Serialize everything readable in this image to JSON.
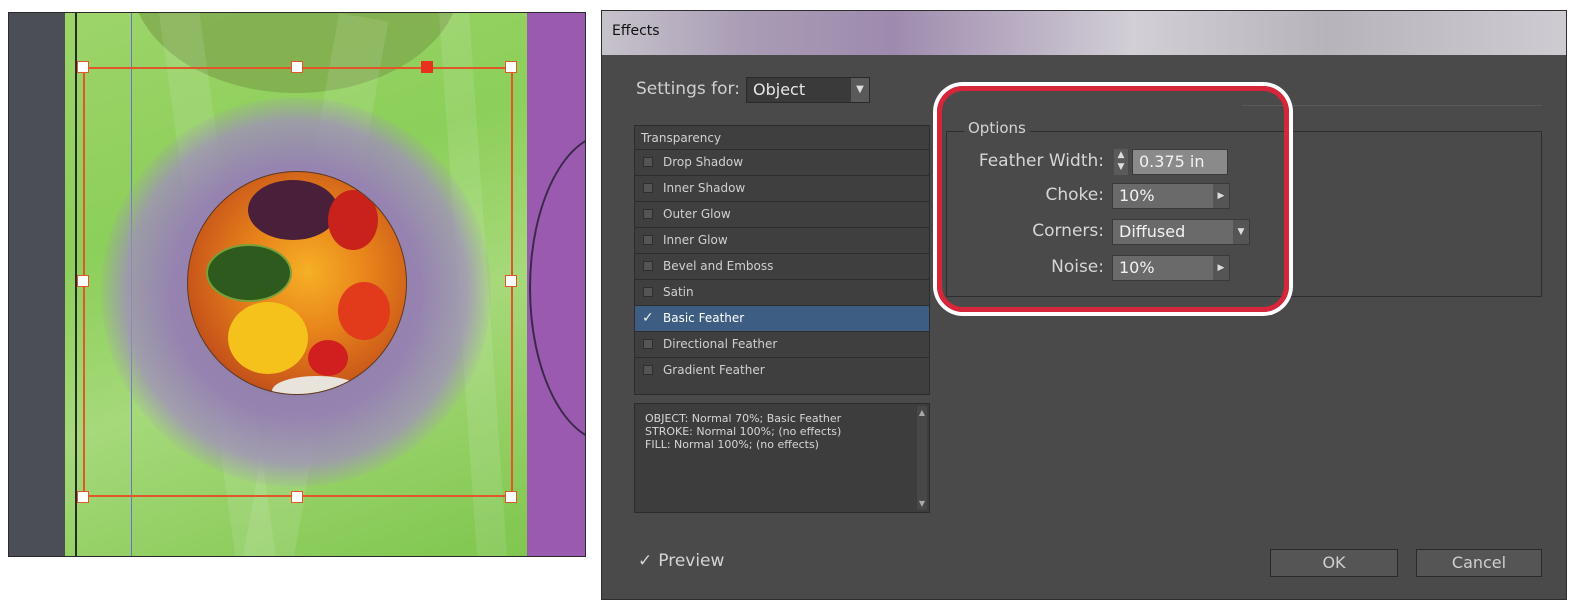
{
  "dialog": {
    "title": "Effects",
    "settings_for": {
      "label": "Settings for:",
      "value": "Object"
    },
    "effects": {
      "header": "Transparency",
      "items": [
        {
          "label": "Drop Shadow",
          "checked": false
        },
        {
          "label": "Inner Shadow",
          "checked": false
        },
        {
          "label": "Outer Glow",
          "checked": false
        },
        {
          "label": "Inner Glow",
          "checked": false
        },
        {
          "label": "Bevel and Emboss",
          "checked": false
        },
        {
          "label": "Satin",
          "checked": false
        },
        {
          "label": "Basic Feather",
          "checked": true,
          "selected": true
        },
        {
          "label": "Directional Feather",
          "checked": false
        },
        {
          "label": "Gradient Feather",
          "checked": false
        }
      ]
    },
    "summary": [
      "OBJECT: Normal 70%; Basic Feather",
      "STROKE: Normal 100%; (no effects)",
      "FILL: Normal 100%; (no effects)"
    ],
    "options": {
      "legend": "Options",
      "feather_width": {
        "label": "Feather Width:",
        "value": "0.375 in"
      },
      "choke": {
        "label": "Choke:",
        "value": "10%"
      },
      "corners": {
        "label": "Corners:",
        "value": "Diffused"
      },
      "noise": {
        "label": "Noise:",
        "value": "10%"
      }
    },
    "preview": {
      "label": "Preview",
      "checked": true
    },
    "buttons": {
      "ok": "OK",
      "cancel": "Cancel"
    }
  },
  "colors": {
    "dialog_bg": "#4a4a4a",
    "selection": "#3e5d82",
    "highlight_ring": "#d7263a",
    "frame_selection": "#e2572a"
  }
}
